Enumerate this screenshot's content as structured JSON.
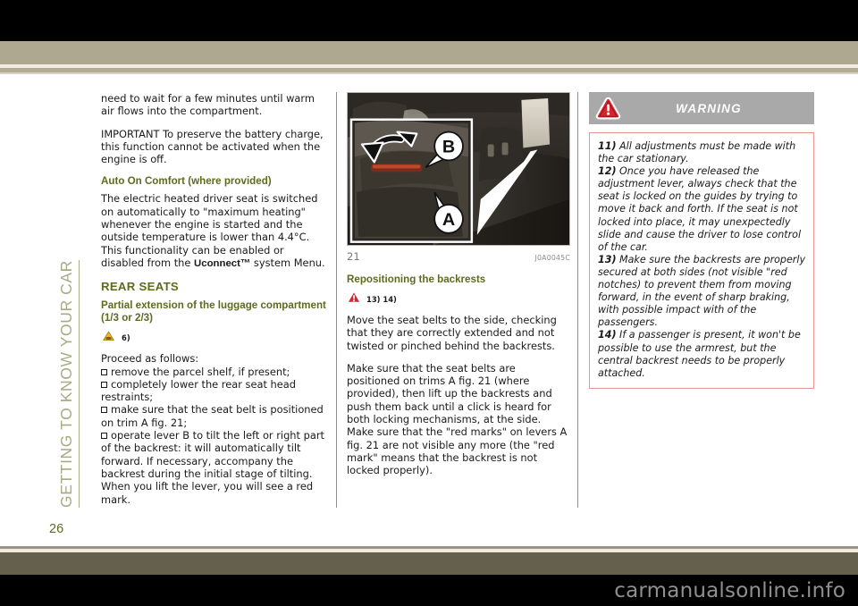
{
  "document": {
    "running_head": "GETTING TO KNOW YOUR CAR",
    "page_number": "26",
    "watermark": "carmanualsonline.info"
  },
  "colors": {
    "heading_green": "#5d6b1f",
    "running_head_green": "#a8ab84",
    "band_tan": "#afa890",
    "band_olive": "#655f4d",
    "warning_header_gray": "#a9a9a9",
    "warning_border_red": "#e8938f",
    "warning_icon_red": "#d8242c",
    "caution_icon_yellow": "#e8b934"
  },
  "left_column": {
    "para_1": "need to wait for a few minutes until warm air flows into the compartment.",
    "para_2": "IMPORTANT To preserve the battery charge, this function cannot be activated when the engine is off.",
    "heading_1": "Auto On Comfort (where provided)",
    "para_3_before": "The electric heated driver seat is switched on automatically to \"maximum heating\" whenever the engine is started and the outside temperature is lower than 4.4°C. This functionality can be enabled or disabled from the ",
    "para_3_bold": "Uconnect™",
    "para_3_after": " system Menu.",
    "heading_2": "REAR SEATS",
    "heading_3": "Partial extension of the luggage compartment (1/3 or 2/3)",
    "caution_icon": "caution-triangle-icon",
    "caution_ref": "6)",
    "para_4": "Proceed as follows:",
    "bullets": [
      "remove the parcel shelf, if present;",
      "completely lower the rear seat head restraints;",
      "make sure that the seat belt is positioned on trim A fig. 21;",
      "operate lever B to tilt the left or right part of the backrest: it will automatically tilt forward. If necessary, accompany the backrest during the initial stage of tilting. When you lift the lever, you will see a red mark."
    ]
  },
  "middle_column": {
    "figure": {
      "alt": "rear seat backrest release lever photograph",
      "callout_a": "A",
      "callout_b": "B",
      "number": "21",
      "code": "J0A0045C"
    },
    "heading_1": "Repositioning the backrests",
    "warning_icon": "warning-triangle-icon",
    "warning_refs": "13) 14)",
    "para_1": "Move the seat belts to the side, checking that they are correctly extended and not twisted or pinched behind the backrests.",
    "para_2": "Make sure that the seat belts are positioned on trims A fig. 21 (where provided), then lift up the backrests and push them back until a click is heard for both locking mechanisms, at the side. Make sure that the \"red marks\" on levers A fig. 21 are not visible any more (the \"red mark\" means that the backrest is not locked properly)."
  },
  "right_column": {
    "warning_header_icon": "warning-triangle-icon",
    "warning_title": "WARNING",
    "notes": [
      {
        "num": "11)",
        "text": " All adjustments must be made with the car stationary."
      },
      {
        "num": "12)",
        "text": " Once you have released the adjustment lever, always check that the seat is locked on the guides by trying to move it back and forth. If the seat is not locked into place, it may unexpectedly slide and cause the driver to lose control of the car."
      },
      {
        "num": "13)",
        "text": " Make sure the backrests are properly secured at both sides (not visible \"red notches) to prevent them from moving forward, in the event of sharp braking, with possible impact with of the passengers."
      },
      {
        "num": "14)",
        "text": " If a passenger is present, it won't be possible to use the armrest, but the central backrest needs to be properly attached."
      }
    ]
  }
}
